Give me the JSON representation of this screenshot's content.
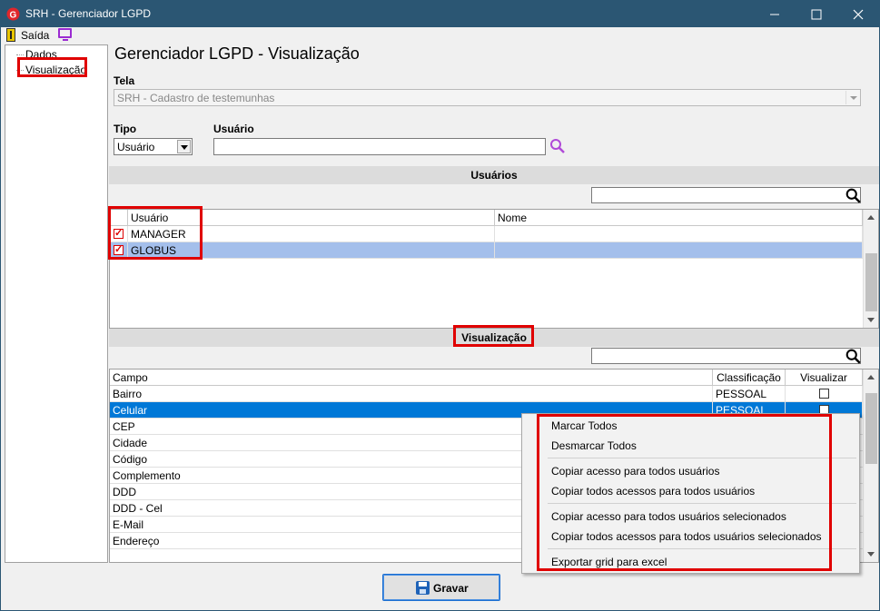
{
  "window": {
    "title": "SRH - Gerenciador LGPD"
  },
  "menu": {
    "exit_label": "Saída"
  },
  "tree": {
    "items": [
      "Dados",
      "Visualização"
    ]
  },
  "page": {
    "heading": "Gerenciador LGPD - Visualização"
  },
  "tela": {
    "label": "Tela",
    "value": "SRH - Cadastro de testemunhas"
  },
  "tipo": {
    "label": "Tipo",
    "value": "Usuário"
  },
  "usuario": {
    "label": "Usuário",
    "value": ""
  },
  "users_section": {
    "title": "Usuários",
    "columns": [
      "Usuário",
      "Nome"
    ],
    "rows": [
      {
        "user": "MANAGER",
        "name": "",
        "checked": true
      },
      {
        "user": "GLOBUS",
        "name": "",
        "checked": true
      }
    ]
  },
  "visual_section": {
    "title": "Visualização",
    "columns": [
      "Campo",
      "Classificação",
      "Visualizar"
    ],
    "rows": [
      {
        "campo": "Bairro",
        "classificacao": "PESSOAL"
      },
      {
        "campo": "Celular",
        "classificacao": "PESSOAL"
      },
      {
        "campo": "CEP",
        "classificacao": ""
      },
      {
        "campo": "Cidade",
        "classificacao": ""
      },
      {
        "campo": "Código",
        "classificacao": ""
      },
      {
        "campo": "Complemento",
        "classificacao": ""
      },
      {
        "campo": "DDD",
        "classificacao": ""
      },
      {
        "campo": "DDD - Cel",
        "classificacao": ""
      },
      {
        "campo": "E-Mail",
        "classificacao": ""
      },
      {
        "campo": "Endereço",
        "classificacao": ""
      }
    ]
  },
  "context_menu": {
    "items": [
      "Marcar Todos",
      "Desmarcar Todos",
      "Copiar acesso para todos usuários",
      "Copiar todos acessos para todos usuários",
      "Copiar acesso para todos usuários selecionados",
      "Copiar todos acessos para todos usuários selecionados",
      "Exportar grid para excel"
    ]
  },
  "save_button": {
    "label": "Gravar"
  },
  "colors": {
    "titlebar": "#2b5673",
    "selection": "#0078d7",
    "selected_row": "#a4bfeb",
    "annotation": "#e00000"
  }
}
